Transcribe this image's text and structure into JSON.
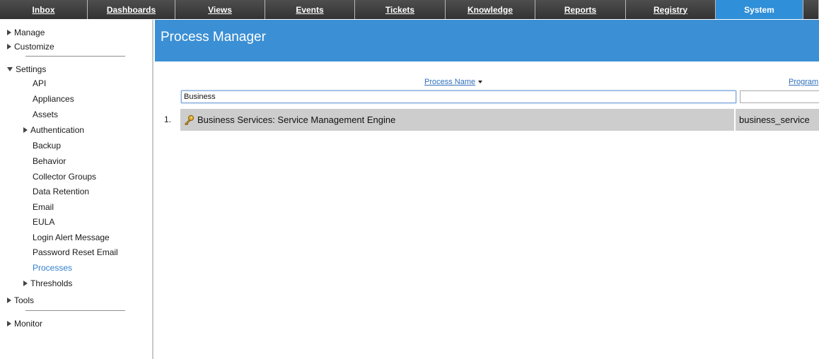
{
  "nav": {
    "tabs": [
      {
        "label": "Inbox",
        "active": false
      },
      {
        "label": "Dashboards",
        "active": false
      },
      {
        "label": "Views",
        "active": false
      },
      {
        "label": "Events",
        "active": false
      },
      {
        "label": "Tickets",
        "active": false
      },
      {
        "label": "Knowledge",
        "active": false
      },
      {
        "label": "Reports",
        "active": false
      },
      {
        "label": "Registry",
        "active": false
      },
      {
        "label": "System",
        "active": true
      }
    ]
  },
  "sidebar": {
    "manage": "Manage",
    "customize": "Customize",
    "settings": "Settings",
    "settings_items": [
      "API",
      "Appliances",
      "Assets",
      "Authentication",
      "Backup",
      "Behavior",
      "Collector Groups",
      "Data Retention",
      "Email",
      "EULA",
      "Login Alert Message",
      "Password Reset Email",
      "Processes",
      "Thresholds"
    ],
    "active_item": "Processes",
    "tools": "Tools",
    "monitor": "Monitor"
  },
  "main": {
    "title": "Process Manager",
    "columns": {
      "process_name": "Process Name",
      "program": "Program"
    },
    "filters": {
      "process_name_value": "Business",
      "program_value": ""
    },
    "rows": [
      {
        "index": "1.",
        "process_name": "Business Services: Service Management Engine",
        "program": "business_service"
      }
    ]
  },
  "colors": {
    "accent": "#3b8fd4",
    "active_tab": "#2f8fd8",
    "nav_bg": "#3d3d3d",
    "row_bg": "#cdcdcd",
    "link": "#2f6fbd"
  }
}
